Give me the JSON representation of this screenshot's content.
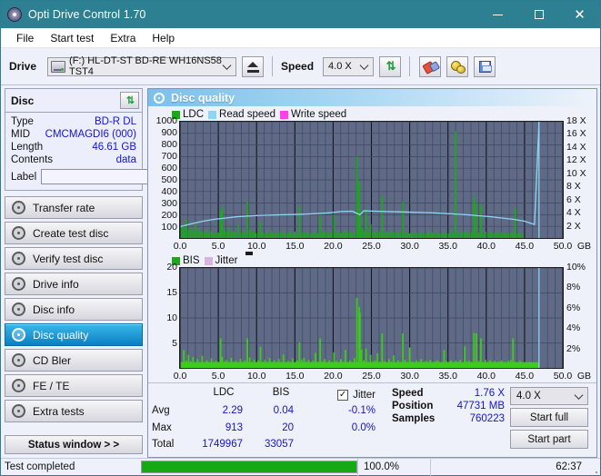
{
  "window": {
    "title": "Opti Drive Control 1.70",
    "icon": "disc-icon",
    "minimize": "minimize-icon",
    "maximize": "maximize-icon",
    "close": "close-icon"
  },
  "menu": {
    "items": [
      "File",
      "Start test",
      "Extra",
      "Help"
    ]
  },
  "toolbar": {
    "drive_label": "Drive",
    "drive_value": "(F:)  HL-DT-ST BD-RE  WH16NS58 TST4",
    "eject_icon": "eject-icon",
    "speed_label": "Speed",
    "speed_value": "4.0 X",
    "refresh_icon": "refresh-icon",
    "eraser_icon": "eraser-icon",
    "bulb_icon": "bulb-icon",
    "save_icon": "floppy-save-icon"
  },
  "disc_panel": {
    "title": "Disc",
    "refresh_icon": "refresh-icon",
    "rows": [
      {
        "label": "Type",
        "value": "BD-R DL"
      },
      {
        "label": "MID",
        "value": "CMCMAGDI6 (000)"
      },
      {
        "label": "Length",
        "value": "46.61 GB"
      },
      {
        "label": "Contents",
        "value": "data"
      }
    ],
    "label_field_label": "Label",
    "label_field_value": "",
    "label_button_icon": "disc-icon"
  },
  "sidebar": {
    "items": [
      {
        "label": "Transfer rate",
        "active": false
      },
      {
        "label": "Create test disc",
        "active": false
      },
      {
        "label": "Verify test disc",
        "active": false
      },
      {
        "label": "Drive info",
        "active": false
      },
      {
        "label": "Disc info",
        "active": false
      },
      {
        "label": "Disc quality",
        "active": true
      },
      {
        "label": "CD Bler",
        "active": false
      },
      {
        "label": "FE / TE",
        "active": false
      },
      {
        "label": "Extra tests",
        "active": false
      }
    ],
    "status_window_button": "Status window > >"
  },
  "panel": {
    "title": "Disc quality",
    "icon": "disc-quality-icon"
  },
  "stats": {
    "columns": [
      "LDC",
      "BIS"
    ],
    "jitter_label": "Jitter",
    "jitter_checked": true,
    "rows": [
      {
        "label": "Avg",
        "ldc": "2.29",
        "bis": "0.04",
        "jitter": "-0.1%"
      },
      {
        "label": "Max",
        "ldc": "913",
        "bis": "20",
        "jitter": "0.0%"
      },
      {
        "label": "Total",
        "ldc": "1749967",
        "bis": "33057",
        "jitter": ""
      }
    ],
    "speed_label": "Speed",
    "speed_value": "1.76 X",
    "position_label": "Position",
    "position_value": "47731 MB",
    "samples_label": "Samples",
    "samples_value": "760223",
    "speed_select": "4.0 X",
    "start_full_button": "Start full",
    "start_part_button": "Start part"
  },
  "statusbar": {
    "text": "Test completed",
    "progress_percent": "100.0%",
    "progress_value": 100,
    "elapsed": "62:37"
  },
  "colors": {
    "accent": "#2d7f92",
    "plot_bg": "#5f6a86",
    "ldc_green": "#18aa18",
    "bis_green": "#3ecb1b",
    "read_speed": "#8fd6f5",
    "write_speed": "#ff3ff0",
    "jitter": "#d8b4e0",
    "value_blue": "#1414d0",
    "progress_green": "#16a916",
    "active_nav": "#0a7fc4"
  },
  "chart_data": [
    {
      "type": "bar",
      "id": "ldc-chart",
      "title": "",
      "xlabel": "GB",
      "ylabel": "LDC",
      "xlim": [
        0,
        50
      ],
      "ylim": [
        0,
        1000
      ],
      "y2lim": [
        0,
        18
      ],
      "y2label": "X",
      "xticks": [
        "0.0",
        "5.0",
        "10.0",
        "15.0",
        "20.0",
        "25.0",
        "30.0",
        "35.0",
        "40.0",
        "45.0",
        "50.0"
      ],
      "yticks": [
        100,
        200,
        300,
        400,
        500,
        600,
        700,
        800,
        900,
        1000
      ],
      "y2ticks": [
        "2 X",
        "4 X",
        "6 X",
        "8 X",
        "10 X",
        "12 X",
        "14 X",
        "16 X",
        "18 X"
      ],
      "legend": [
        {
          "name": "LDC",
          "color": "#18aa18"
        },
        {
          "name": "Read speed",
          "color": "#8fd6f5"
        },
        {
          "name": "Write speed",
          "color": "#ff3ff0"
        }
      ],
      "grid": true,
      "legend_position": "top-left",
      "series": [
        {
          "name": "LDC",
          "type": "bar",
          "color": "#18aa18",
          "x": [
            0.2,
            0.5,
            0.8,
            1.1,
            1.4,
            1.7,
            2.0,
            2.3,
            2.6,
            2.9,
            3.2,
            3.5,
            3.8,
            4.1,
            4.4,
            4.7,
            5.0,
            5.3,
            5.5,
            5.8,
            6.1,
            6.4,
            6.7,
            7.0,
            7.3,
            7.6,
            7.9,
            8.2,
            8.5,
            8.8,
            9.1,
            9.4,
            9.7,
            9.9,
            10.2,
            10.5,
            10.8,
            11.1,
            11.4,
            11.7,
            12.0,
            12.3,
            12.6,
            12.9,
            13.2,
            13.5,
            13.8,
            14.1,
            14.4,
            14.7,
            15.0,
            15.3,
            15.6,
            15.9,
            16.2,
            16.5,
            16.8,
            17.1,
            17.4,
            17.7,
            18.0,
            18.3,
            18.6,
            18.9,
            19.2,
            19.5,
            19.8,
            20.1,
            20.4,
            20.7,
            21.0,
            21.3,
            21.6,
            21.9,
            22.2,
            22.5,
            22.8,
            23.1,
            23.4,
            23.5,
            23.7,
            24.0,
            24.3,
            24.6,
            24.9,
            25.2,
            25.5,
            25.8,
            26.1,
            26.4,
            26.7,
            27.0,
            27.3,
            27.6,
            27.9,
            28.2,
            28.5,
            28.8,
            29.1,
            29.4,
            29.7,
            30.0,
            30.3,
            30.6,
            30.9,
            31.2,
            31.5,
            31.8,
            32.1,
            32.4,
            32.7,
            33.0,
            33.3,
            33.6,
            33.9,
            34.2,
            34.5,
            34.8,
            35.1,
            35.4,
            35.7,
            36.0,
            36.3,
            36.6,
            36.9,
            37.2,
            37.5,
            37.8,
            38.1,
            38.4,
            38.7,
            39.0,
            39.3,
            39.6,
            39.9,
            40.2,
            40.5,
            40.8,
            41.1,
            41.4,
            41.7,
            42.0,
            42.3,
            42.6,
            42.9,
            43.2,
            43.5,
            43.8,
            44.1,
            44.4,
            44.7,
            45.0,
            45.3,
            45.6,
            45.9,
            46.2,
            46.5,
            46.8
          ],
          "values": [
            110,
            90,
            160,
            70,
            95,
            60,
            120,
            55,
            80,
            50,
            45,
            70,
            40,
            60,
            35,
            50,
            45,
            230,
            270,
            65,
            55,
            90,
            50,
            60,
            45,
            120,
            40,
            55,
            50,
            310,
            70,
            45,
            60,
            40,
            50,
            140,
            45,
            35,
            55,
            40,
            60,
            35,
            45,
            50,
            40,
            60,
            35,
            45,
            50,
            40,
            55,
            35,
            280,
            45,
            60,
            40,
            50,
            35,
            45,
            55,
            40,
            190,
            50,
            60,
            45,
            35,
            50,
            200,
            45,
            60,
            40,
            50,
            65,
            45,
            55,
            40,
            50,
            700,
            480,
            230,
            90,
            60,
            250,
            45,
            120,
            55,
            45,
            60,
            50,
            360,
            45,
            55,
            40,
            60,
            50,
            45,
            55,
            40,
            310,
            50,
            45,
            40,
            55,
            35,
            45,
            50,
            40,
            45,
            35,
            50,
            40,
            45,
            55,
            35,
            40,
            50,
            45,
            35,
            40,
            70,
            45,
            915,
            55,
            40,
            50,
            45,
            60,
            35,
            50,
            355,
            300,
            45,
            285,
            40,
            55,
            35,
            50,
            45,
            40,
            55,
            35,
            45,
            50,
            40,
            35,
            45,
            50,
            260,
            40,
            35,
            45
          ]
        },
        {
          "name": "Read speed",
          "type": "line",
          "color": "#8fd6f5",
          "x": [
            0.1,
            1.5,
            3,
            4.5,
            6,
            7.5,
            9,
            10.5,
            12,
            13.5,
            15,
            16.5,
            18,
            19.5,
            21,
            22.5,
            23.5,
            24,
            25.5,
            27,
            28.5,
            30,
            31.5,
            33,
            34.5,
            36,
            37.5,
            39,
            40.5,
            42,
            43.5,
            45,
            46.3,
            46.9
          ],
          "values": [
            1.8,
            2.2,
            2.6,
            2.9,
            3.1,
            3.3,
            3.4,
            3.5,
            3.55,
            3.6,
            3.65,
            3.7,
            3.8,
            3.9,
            4.1,
            4.15,
            3.6,
            4.2,
            4.15,
            4.1,
            4.05,
            4.0,
            3.95,
            3.9,
            3.8,
            3.7,
            3.6,
            3.45,
            3.3,
            3.1,
            2.9,
            2.6,
            2.1,
            18.0
          ]
        }
      ]
    },
    {
      "type": "bar",
      "id": "bis-chart",
      "title": "",
      "xlabel": "GB",
      "ylabel": "BIS",
      "xlim": [
        0,
        50
      ],
      "ylim": [
        0,
        20
      ],
      "y2lim": [
        0,
        10
      ],
      "y2label": "%",
      "xticks": [
        "0.0",
        "5.0",
        "10.0",
        "15.0",
        "20.0",
        "25.0",
        "30.0",
        "35.0",
        "40.0",
        "45.0",
        "50.0"
      ],
      "yticks": [
        5,
        10,
        15,
        20
      ],
      "y2ticks": [
        "2%",
        "4%",
        "6%",
        "8%",
        "10%"
      ],
      "legend": [
        {
          "name": "BIS",
          "color": "#18aa18"
        },
        {
          "name": "Jitter",
          "color": "#d8b4e0"
        }
      ],
      "grid": true,
      "legend_position": "top-left",
      "series": [
        {
          "name": "BIS",
          "type": "bar",
          "color": "#3ecb1b",
          "x": [
            0.2,
            0.5,
            0.8,
            1.1,
            1.4,
            1.7,
            2.0,
            2.3,
            2.6,
            2.9,
            3.2,
            3.5,
            3.8,
            4.1,
            4.4,
            4.7,
            5.0,
            5.3,
            5.5,
            5.8,
            6.1,
            6.4,
            6.7,
            7.0,
            7.3,
            7.6,
            7.9,
            8.2,
            8.5,
            8.8,
            9.1,
            9.4,
            9.7,
            9.9,
            10.2,
            10.5,
            10.8,
            11.1,
            11.4,
            11.7,
            12.0,
            12.3,
            12.6,
            12.9,
            13.2,
            13.5,
            13.8,
            14.1,
            14.4,
            14.7,
            15.0,
            15.3,
            15.6,
            15.9,
            16.2,
            16.5,
            16.8,
            17.1,
            17.4,
            17.7,
            18.0,
            18.3,
            18.6,
            18.9,
            19.2,
            19.5,
            19.8,
            20.1,
            20.4,
            20.7,
            21.0,
            21.3,
            21.6,
            21.9,
            22.2,
            22.5,
            22.8,
            23.1,
            23.4,
            23.5,
            23.7,
            24.0,
            24.3,
            24.6,
            24.9,
            25.2,
            25.5,
            25.8,
            26.1,
            26.4,
            26.7,
            27.0,
            27.3,
            27.6,
            27.9,
            28.2,
            28.5,
            28.8,
            29.1,
            29.4,
            29.7,
            30.0,
            30.3,
            30.6,
            30.9,
            31.2,
            31.5,
            31.8,
            32.1,
            32.4,
            32.7,
            33.0,
            33.3,
            33.6,
            33.9,
            34.2,
            34.5,
            34.8,
            35.1,
            35.4,
            35.7,
            36.0,
            36.3,
            36.6,
            36.9,
            37.2,
            37.5,
            37.8,
            38.1,
            38.4,
            38.7,
            39.0,
            39.3,
            39.6,
            39.9,
            40.2,
            40.5,
            40.8,
            41.1,
            41.4,
            41.7,
            42.0,
            42.3,
            42.6,
            42.9,
            43.2,
            43.5,
            43.8,
            44.1,
            44.4,
            44.7,
            45.0,
            45.3,
            45.6,
            45.9,
            46.2,
            46.5,
            46.8
          ],
          "values": [
            1.2,
            3.6,
            1.5,
            2.6,
            1.3,
            2.2,
            1.1,
            1.8,
            1.2,
            2.4,
            1.1,
            1.5,
            1.0,
            1.9,
            1.1,
            1.4,
            1.2,
            5.9,
            2.2,
            1.3,
            1.6,
            1.1,
            2.0,
            1.2,
            1.4,
            1.1,
            1.8,
            1.2,
            1.5,
            5.9,
            2.1,
            1.2,
            1.7,
            1.1,
            1.5,
            4.2,
            1.2,
            1.6,
            1.1,
            2.0,
            1.2,
            1.5,
            1.1,
            1.8,
            1.2,
            2.7,
            1.1,
            1.4,
            1.2,
            1.9,
            1.1,
            1.5,
            5.1,
            1.7,
            2.0,
            1.2,
            1.6,
            1.1,
            1.4,
            3.0,
            1.2,
            5.9,
            1.3,
            1.8,
            1.1,
            1.5,
            1.2,
            3.1,
            1.4,
            1.1,
            1.8,
            1.2,
            3.6,
            1.1,
            1.5,
            1.2,
            2.0,
            14.0,
            12.2,
            11.0,
            3.7,
            1.5,
            3.9,
            1.2,
            2.6,
            1.3,
            1.5,
            2.9,
            1.2,
            6.9,
            1.4,
            1.1,
            1.8,
            1.2,
            2.5,
            1.1,
            1.5,
            1.2,
            6.9,
            1.6,
            1.2,
            4.1,
            1.3,
            1.1,
            1.5,
            1.2,
            1.8,
            1.1,
            1.4,
            1.2,
            1.6,
            1.1,
            1.3,
            1.5,
            1.2,
            1.1,
            3.6,
            1.3,
            1.2,
            1.5,
            1.1,
            1.4,
            1.2,
            1.6,
            1.1,
            4.3,
            1.3,
            1.5,
            1.2,
            7.0,
            6.9,
            1.4,
            5.9,
            1.2,
            1.6,
            1.1,
            1.5,
            1.2,
            1.4,
            1.1,
            1.3,
            1.5,
            1.2,
            1.1,
            1.4,
            1.6,
            5.9,
            1.2,
            1.1,
            1.4
          ]
        },
        {
          "name": "Jitter",
          "type": "line",
          "color": "#d8b4e0",
          "x": [],
          "values": []
        }
      ]
    }
  ]
}
